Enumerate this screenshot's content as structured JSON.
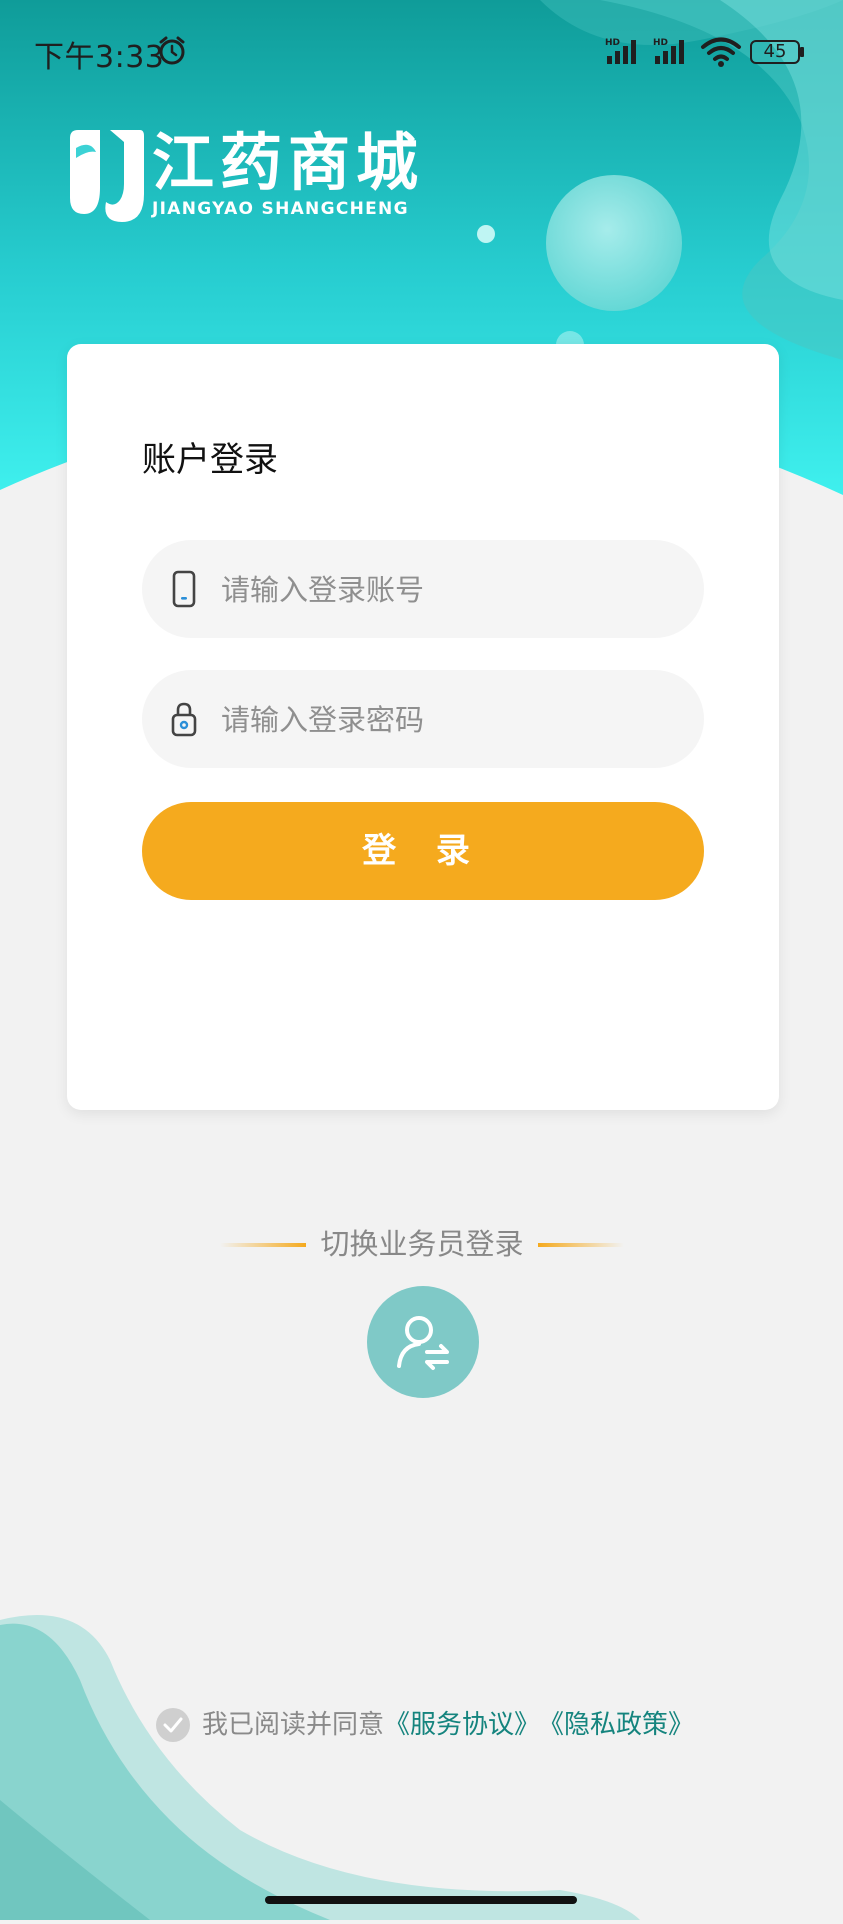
{
  "status_bar": {
    "time": "下午3:33",
    "signal_1_label": "HD",
    "signal_2_label": "HD",
    "battery": "45",
    "icons": [
      "alarm-icon",
      "signal-icon",
      "signal-icon",
      "wifi-icon",
      "battery-icon"
    ]
  },
  "brand": {
    "name_cn": "江药商城",
    "name_en": "JIANGYAO SHANGCHENG",
    "logo_icon": "brand-logo-icon",
    "colors": {
      "primary": "#27cfd0",
      "accent": "#f5aa1e",
      "link": "#15847e"
    }
  },
  "login_card": {
    "title": "账户登录",
    "account_field": {
      "placeholder": "请输入登录账号",
      "value": "",
      "icon": "phone-icon"
    },
    "password_field": {
      "placeholder": "请输入登录密码",
      "value": "",
      "icon": "lock-icon"
    },
    "login_button_label": "登 录"
  },
  "switch": {
    "label": "切换业务员登录",
    "icon": "user-switch-icon"
  },
  "agreement": {
    "prefix": "我已阅读并同意",
    "service_link": "《服务协议》",
    "privacy_link": "《隐私政策》",
    "checked": true
  }
}
